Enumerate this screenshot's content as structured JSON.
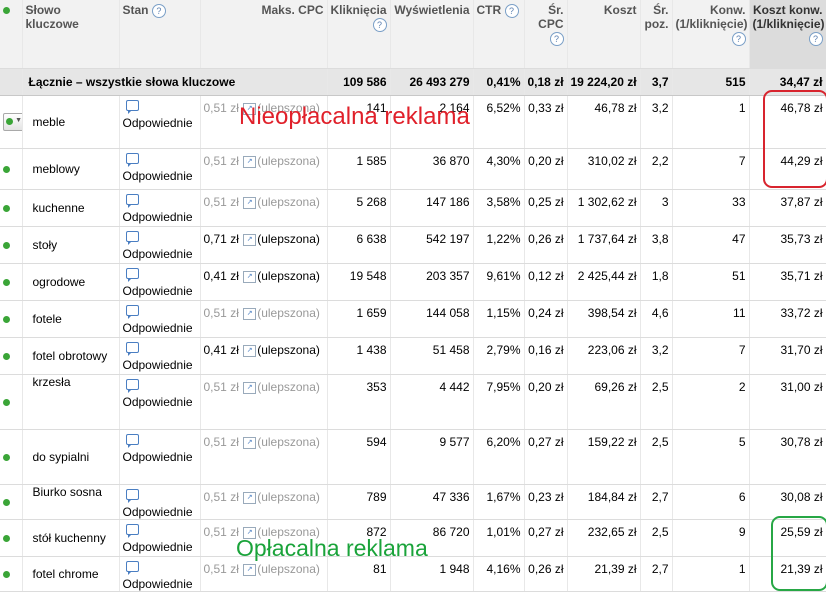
{
  "headers": {
    "keyword": "Słowo kluczowe",
    "status": "Stan",
    "max_cpc": "Maks. CPC",
    "clicks": "Kliknięcia",
    "impressions": "Wyświetlenia",
    "ctr": "CTR",
    "avg_cpc": "Śr. CPC",
    "cost": "Koszt",
    "avg_pos": "Śr. poz.",
    "conv": "Konw. (1/kliknięcie)",
    "cost_conv": "Koszt konw. (1/kliknięcie)",
    "help": "?"
  },
  "total": {
    "label": "Łącznie – wszystkie słowa kluczowe",
    "clicks": "109 586",
    "impressions": "26 493 279",
    "ctr": "0,41%",
    "avg_cpc": "0,18 zł",
    "cost": "19 224,20 zł",
    "avg_pos": "3,7",
    "conv": "515",
    "cost_conv": "34,47 zł"
  },
  "rows": [
    {
      "keyword": "meble",
      "status": "Odpowiednie",
      "max_cpc": "0,51 zł",
      "cpc_note": "(ulepszona)",
      "clicks": "141",
      "impressions": "2 164",
      "ctr": "6,52%",
      "avg_cpc": "0,33 zł",
      "cost": "46,78 zł",
      "avg_pos": "3,2",
      "conv": "1",
      "cost_conv": "46,78 zł"
    },
    {
      "keyword": "meblowy",
      "status": "Odpowiednie",
      "max_cpc": "0,51 zł",
      "cpc_note": "(ulepszona)",
      "clicks": "1 585",
      "impressions": "36 870",
      "ctr": "4,30%",
      "avg_cpc": "0,20 zł",
      "cost": "310,02 zł",
      "avg_pos": "2,2",
      "conv": "7",
      "cost_conv": "44,29 zł"
    },
    {
      "keyword": "kuchenne",
      "status": "Odpowiednie",
      "max_cpc": "0,51 zł",
      "cpc_note": "(ulepszona)",
      "clicks": "5 268",
      "impressions": "147 186",
      "ctr": "3,58%",
      "avg_cpc": "0,25 zł",
      "cost": "1 302,62 zł",
      "avg_pos": "3",
      "conv": "33",
      "cost_conv": "37,87 zł"
    },
    {
      "keyword": "stoły",
      "status": "Odpowiednie",
      "max_cpc": "0,71 zł",
      "cpc_note": "(ulepszona)",
      "clicks": "6 638",
      "impressions": "542 197",
      "ctr": "1,22%",
      "avg_cpc": "0,26 zł",
      "cost": "1 737,64 zł",
      "avg_pos": "3,8",
      "conv": "47",
      "cost_conv": "35,73 zł"
    },
    {
      "keyword": "ogrodowe",
      "status": "Odpowiednie",
      "max_cpc": "0,41 zł",
      "cpc_note": "(ulepszona)",
      "clicks": "19 548",
      "impressions": "203 357",
      "ctr": "9,61%",
      "avg_cpc": "0,12 zł",
      "cost": "2 425,44 zł",
      "avg_pos": "1,8",
      "conv": "51",
      "cost_conv": "35,71 zł"
    },
    {
      "keyword": "fotele",
      "status": "Odpowiednie",
      "max_cpc": "0,51 zł",
      "cpc_note": "(ulepszona)",
      "clicks": "1 659",
      "impressions": "144 058",
      "ctr": "1,15%",
      "avg_cpc": "0,24 zł",
      "cost": "398,54 zł",
      "avg_pos": "4,6",
      "conv": "11",
      "cost_conv": "33,72 zł"
    },
    {
      "keyword": "fotel obrotowy",
      "status": "Odpowiednie",
      "max_cpc": "0,41 zł",
      "cpc_note": "(ulepszona)",
      "clicks": "1 438",
      "impressions": "51 458",
      "ctr": "2,79%",
      "avg_cpc": "0,16 zł",
      "cost": "223,06 zł",
      "avg_pos": "3,2",
      "conv": "7",
      "cost_conv": "31,70 zł"
    },
    {
      "keyword": "krzesła",
      "status": "Odpowiednie",
      "max_cpc": "0,51 zł",
      "cpc_note": "(ulepszona)",
      "clicks": "353",
      "impressions": "4 442",
      "ctr": "7,95%",
      "avg_cpc": "0,20 zł",
      "cost": "69,26 zł",
      "avg_pos": "2,5",
      "conv": "2",
      "cost_conv": "31,00 zł"
    },
    {
      "keyword": "do sypialni",
      "status": "Odpowiednie",
      "max_cpc": "0,51 zł",
      "cpc_note": "(ulepszona)",
      "clicks": "594",
      "impressions": "9 577",
      "ctr": "6,20%",
      "avg_cpc": "0,27 zł",
      "cost": "159,22 zł",
      "avg_pos": "2,5",
      "conv": "5",
      "cost_conv": "30,78 zł"
    },
    {
      "keyword": "Biurko sosna",
      "status": "Odpowiednie",
      "max_cpc": "0,51 zł",
      "cpc_note": "(ulepszona)",
      "clicks": "789",
      "impressions": "47 336",
      "ctr": "1,67%",
      "avg_cpc": "0,23 zł",
      "cost": "184,84 zł",
      "avg_pos": "2,7",
      "conv": "6",
      "cost_conv": "30,08 zł"
    },
    {
      "keyword": "stół kuchenny",
      "status": "Odpowiednie",
      "max_cpc": "0,51 zł",
      "cpc_note": "(ulepszona)",
      "clicks": "872",
      "impressions": "86 720",
      "ctr": "1,01%",
      "avg_cpc": "0,27 zł",
      "cost": "232,65 zł",
      "avg_pos": "2,5",
      "conv": "9",
      "cost_conv": "25,59 zł"
    },
    {
      "keyword": "fotel chrome",
      "status": "Odpowiednie",
      "max_cpc": "0,51 zł",
      "cpc_note": "(ulepszona)",
      "clicks": "81",
      "impressions": "1 948",
      "ctr": "4,16%",
      "avg_cpc": "0,26 zł",
      "cost": "21,39 zł",
      "avg_pos": "2,7",
      "conv": "1",
      "cost_conv": "21,39 zł"
    }
  ],
  "annotations": {
    "unprofitable": "Nieopłacalna reklama",
    "profitable": "Opłacalna reklama"
  },
  "colors": {
    "status_dot": "#3aa537",
    "annotation_red": "#e0202a",
    "annotation_green": "#1aa33a",
    "help_icon": "#5a7fb0"
  }
}
